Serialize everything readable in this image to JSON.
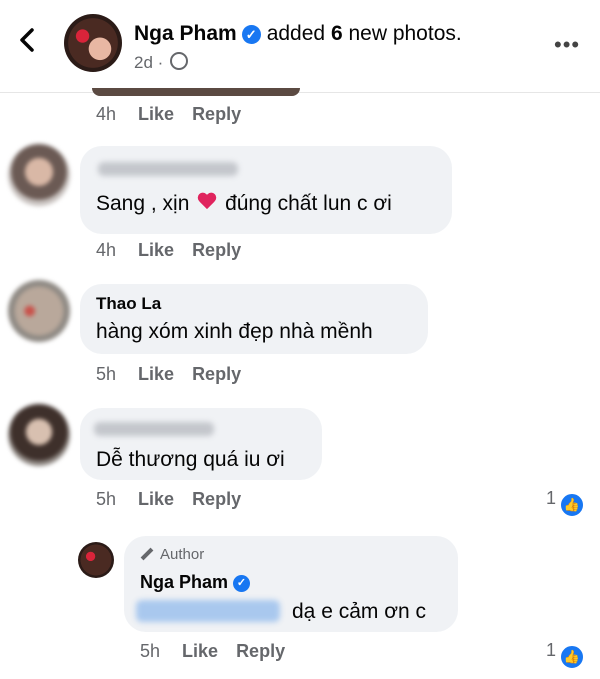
{
  "header": {
    "author": "Nga Pham",
    "action_prefix": "added ",
    "action_count": "6",
    "action_suffix": " new photos.",
    "time": "2d ·",
    "more": "•••"
  },
  "top_meta": {
    "time": "4h",
    "like": "Like",
    "reply": "Reply"
  },
  "comments": [
    {
      "name": "",
      "text_before": "Sang , xịn ",
      "text_after": " đúng chất lun c ơi",
      "time": "4h",
      "like": "Like",
      "reply": "Reply"
    },
    {
      "name": "Thao La",
      "text": "hàng xóm xinh đẹp nhà mềnh",
      "time": "5h",
      "like": "Like",
      "reply": "Reply"
    },
    {
      "name": "",
      "text": "Dễ thương quá iu ơi",
      "time": "5h",
      "like": "Like",
      "reply": "Reply",
      "reactions": "1"
    }
  ],
  "reply": {
    "badge": "Author",
    "name": "Nga Pham",
    "text": "dạ e cảm ơn c",
    "time": "5h",
    "like": "Like",
    "reply": "Reply",
    "reactions": "1"
  },
  "colors": {
    "accent": "#1877f2",
    "bubble": "#f0f2f5",
    "meta": "#65676b"
  }
}
